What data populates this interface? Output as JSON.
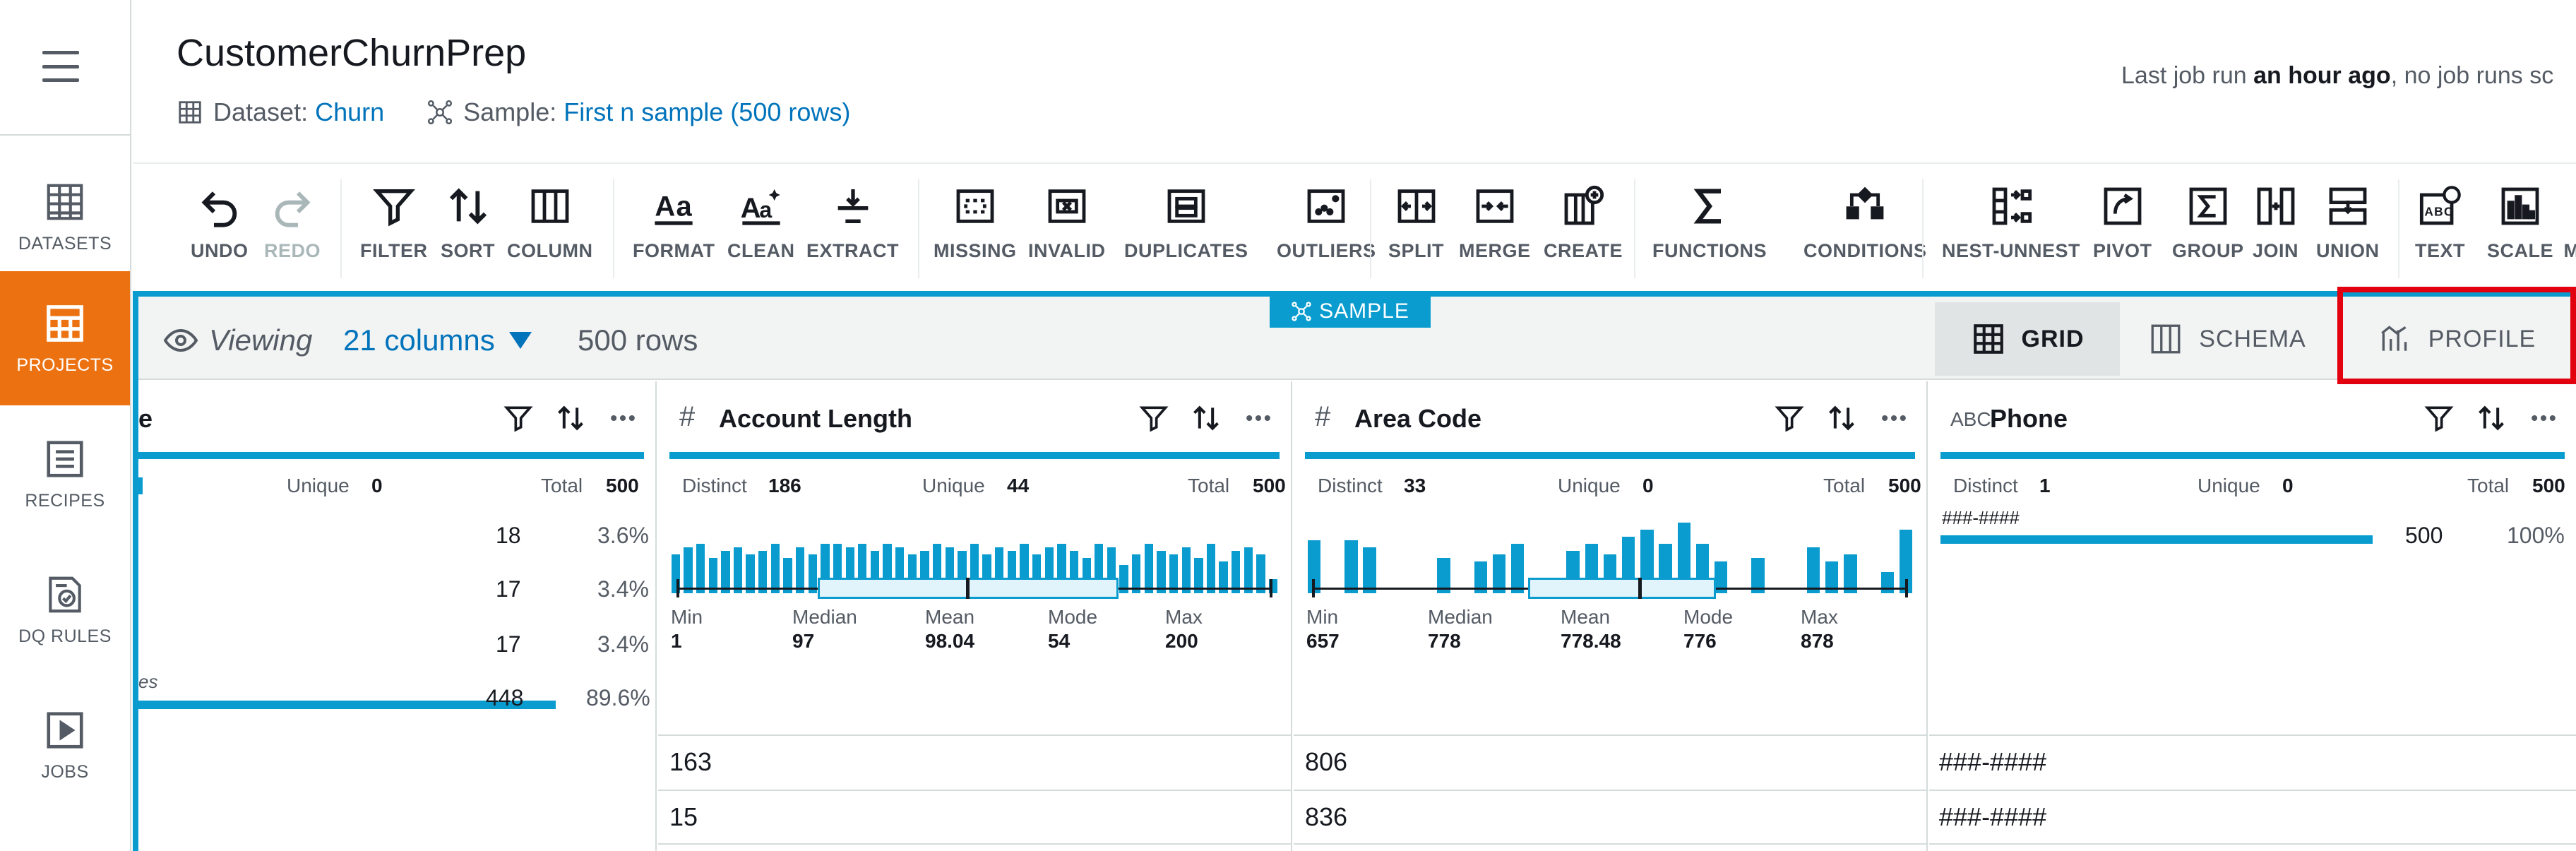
{
  "nav": {
    "items": [
      {
        "label": "DATASETS",
        "icon": "table-icon"
      },
      {
        "label": "PROJECTS",
        "icon": "grid-icon",
        "active": true
      },
      {
        "label": "RECIPES",
        "icon": "list-icon"
      },
      {
        "label": "DQ RULES",
        "icon": "ruleset-icon"
      },
      {
        "label": "JOBS",
        "icon": "play-icon"
      }
    ]
  },
  "header": {
    "title": "CustomerChurnPrep",
    "dataset_prefix": "Dataset:",
    "dataset_name": "Churn",
    "sample_prefix": "Sample:",
    "sample_name": "First n sample (500 rows)",
    "last_run_prefix": "Last job run ",
    "last_run_bold": "an hour ago",
    "last_run_suffix": ", no job runs sc"
  },
  "toolbar": {
    "undo": "UNDO",
    "redo": "REDO",
    "filter": "FILTER",
    "sort": "SORT",
    "column": "COLUMN",
    "format": "FORMAT",
    "clean": "CLEAN",
    "extract": "EXTRACT",
    "missing": "MISSING",
    "invalid": "INVALID",
    "duplicates": "DUPLICATES",
    "outliers": "OUTLIERS",
    "split": "SPLIT",
    "merge": "MERGE",
    "create": "CREATE",
    "functions": "FUNCTIONS",
    "conditions": "CONDITIONS",
    "nest_unnest": "NEST-UNNEST",
    "pivot": "PIVOT",
    "group": "GROUP",
    "join": "JOIN",
    "union": "UNION",
    "text": "TEXT",
    "scale": "SCALE",
    "more": "M"
  },
  "sample_badge": "SAMPLE",
  "viewbar": {
    "viewing": "Viewing",
    "columns": "21 columns",
    "rows": "500 rows",
    "tabs": {
      "grid": "GRID",
      "schema": "SCHEMA",
      "profile": "PROFILE"
    }
  },
  "columns": {
    "col1": {
      "name_tail": "e",
      "unique_label": "Unique",
      "unique": "0",
      "total_label": "Total",
      "total": "500",
      "values": [
        {
          "count": "18",
          "pct": "3.6%"
        },
        {
          "count": "17",
          "pct": "3.4%"
        },
        {
          "count": "17",
          "pct": "3.4%"
        },
        {
          "label": "es",
          "count": "448",
          "pct": "89.6%",
          "fraction": 0.896
        }
      ]
    },
    "account_length": {
      "type": "#",
      "name": "Account Length",
      "distinct_label": "Distinct",
      "distinct": "186",
      "unique_label": "Unique",
      "unique": "44",
      "total_label": "Total",
      "total": "500",
      "summary": {
        "min_l": "Min",
        "min": "1",
        "median_l": "Median",
        "median": "97",
        "mean_l": "Mean",
        "mean": "98.04",
        "mode_l": "Mode",
        "mode": "54",
        "max_l": "Max",
        "max": "200"
      },
      "hist": [
        0.55,
        0.65,
        0.7,
        0.5,
        0.6,
        0.65,
        0.55,
        0.6,
        0.7,
        0.5,
        0.65,
        0.55,
        0.7,
        0.7,
        0.65,
        0.7,
        0.6,
        0.7,
        0.65,
        0.55,
        0.6,
        0.7,
        0.65,
        0.6,
        0.7,
        0.55,
        0.65,
        0.6,
        0.7,
        0.55,
        0.65,
        0.7,
        0.6,
        0.5,
        0.7,
        0.65,
        0.4,
        0.55,
        0.7,
        0.6,
        0.55,
        0.65,
        0.5,
        0.7,
        0.45,
        0.6,
        0.65,
        0.55,
        0.2
      ],
      "rows": [
        "163",
        "15"
      ]
    },
    "area_code": {
      "type": "#",
      "name": "Area Code",
      "distinct_label": "Distinct",
      "distinct": "33",
      "unique_label": "Unique",
      "unique": "0",
      "total_label": "Total",
      "total": "500",
      "summary": {
        "min_l": "Min",
        "min": "657",
        "median_l": "Median",
        "median": "778",
        "mean_l": "Mean",
        "mean": "778.48",
        "mode_l": "Mode",
        "mode": "776",
        "max_l": "Max",
        "max": "878"
      },
      "hist": [
        0.75,
        0,
        0.75,
        0.65,
        0,
        0,
        0,
        0.5,
        0,
        0.45,
        0.55,
        0.7,
        0,
        0,
        0.6,
        0.7,
        0.55,
        0.8,
        0.9,
        0.7,
        1.0,
        0.7,
        0.45,
        0,
        0.5,
        0,
        0,
        0.65,
        0.45,
        0.55,
        0,
        0.3,
        0.9
      ],
      "rows": [
        "806",
        "836"
      ]
    },
    "phone": {
      "type": "ABC",
      "name": "Phone",
      "distinct_label": "Distinct",
      "distinct": "1",
      "unique_label": "Unique",
      "unique": "0",
      "total_label": "Total",
      "total": "500",
      "top_value": "###-####",
      "top_count": "500",
      "top_pct": "100%",
      "top_fraction": 1.0,
      "rows": [
        "###-####",
        "###-####"
      ]
    }
  },
  "colors": {
    "accent": "#0a9ccf",
    "active_nav": "#ec7211",
    "highlight": "#e3000f",
    "link": "#0073bb"
  }
}
